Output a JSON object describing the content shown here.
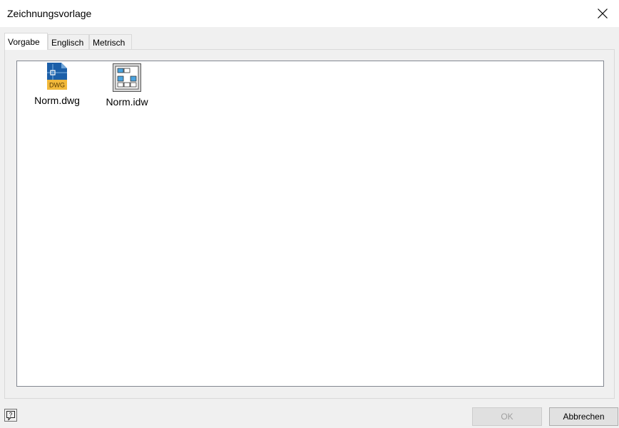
{
  "window": {
    "title": "Zeichnungsvorlage",
    "close_icon": "close-icon"
  },
  "tabs": [
    {
      "label": "Vorgabe",
      "active": true
    },
    {
      "label": "Englisch",
      "active": false
    },
    {
      "label": "Metrisch",
      "active": false
    }
  ],
  "files": [
    {
      "name": "Norm.dwg",
      "icon": "dwg-file-icon",
      "badge": "DWG"
    },
    {
      "name": "Norm.idw",
      "icon": "idw-file-icon"
    }
  ],
  "footer": {
    "help_icon": "help-icon",
    "ok_label": "OK",
    "ok_enabled": false,
    "cancel_label": "Abbrechen"
  },
  "colors": {
    "dwg_blue": "#1c5fa8",
    "dwg_badge": "#f2b93b",
    "idw_blue": "#4aa3df"
  }
}
